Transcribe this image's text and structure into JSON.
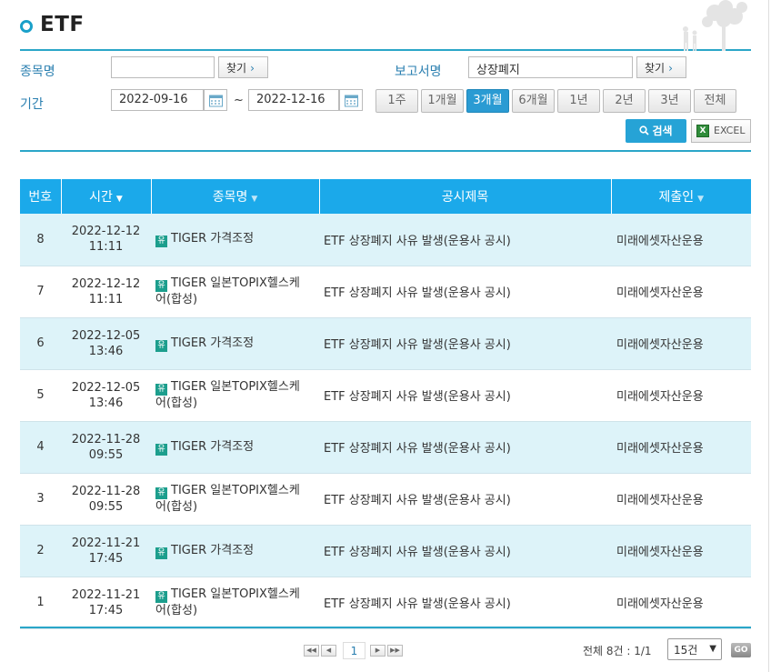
{
  "header": {
    "title": "ETF"
  },
  "search": {
    "stock_label": "종목명",
    "stock_value": "",
    "find_label": "찾기",
    "report_label": "보고서명",
    "report_value": "상장폐지",
    "period_label": "기간",
    "start_date": "2022-09-16",
    "end_date": "2022-12-16",
    "tilde": "~",
    "periods": [
      "1주",
      "1개월",
      "3개월",
      "6개월",
      "1년",
      "2년",
      "3년",
      "전체"
    ],
    "active_period": "3개월",
    "search_button": "검색",
    "excel_button": "EXCEL"
  },
  "table": {
    "headers": [
      "번호",
      "시간",
      "종목명",
      "공시제목",
      "제출인"
    ],
    "rows": [
      {
        "no": "8",
        "date": "2022-12-12",
        "time": "11:11",
        "name1": "TIGER 가격조정",
        "name2": "",
        "title": "ETF 상장폐지 사유 발생(운용사 공시)",
        "submitter": "미래에셋자산운용"
      },
      {
        "no": "7",
        "date": "2022-12-12",
        "time": "11:11",
        "name1": "TIGER 일본TOPIX헬스케",
        "name2": "어(합성)",
        "title": "ETF 상장폐지 사유 발생(운용사 공시)",
        "submitter": "미래에셋자산운용"
      },
      {
        "no": "6",
        "date": "2022-12-05",
        "time": "13:46",
        "name1": "TIGER 가격조정",
        "name2": "",
        "title": "ETF 상장폐지 사유 발생(운용사 공시)",
        "submitter": "미래에셋자산운용"
      },
      {
        "no": "5",
        "date": "2022-12-05",
        "time": "13:46",
        "name1": "TIGER 일본TOPIX헬스케",
        "name2": "어(합성)",
        "title": "ETF 상장폐지 사유 발생(운용사 공시)",
        "submitter": "미래에셋자산운용"
      },
      {
        "no": "4",
        "date": "2022-11-28",
        "time": "09:55",
        "name1": "TIGER 가격조정",
        "name2": "",
        "title": "ETF 상장폐지 사유 발생(운용사 공시)",
        "submitter": "미래에셋자산운용"
      },
      {
        "no": "3",
        "date": "2022-11-28",
        "time": "09:55",
        "name1": "TIGER 일본TOPIX헬스케",
        "name2": "어(합성)",
        "title": "ETF 상장폐지 사유 발생(운용사 공시)",
        "submitter": "미래에셋자산운용"
      },
      {
        "no": "2",
        "date": "2022-11-21",
        "time": "17:45",
        "name1": "TIGER 가격조정",
        "name2": "",
        "title": "ETF 상장폐지 사유 발생(운용사 공시)",
        "submitter": "미래에셋자산운용"
      },
      {
        "no": "1",
        "date": "2022-11-21",
        "time": "17:45",
        "name1": "TIGER 일본TOPIX헬스케",
        "name2": "어(합성)",
        "title": "ETF 상장폐지 사유 발생(운용사 공시)",
        "submitter": "미래에셋자산운용"
      }
    ]
  },
  "pagination": {
    "current_page": "1",
    "total_text": "전체 8건 : 1/1",
    "page_size": "15건",
    "go_label": "GO"
  },
  "colors": {
    "accent": "#1ba9ea",
    "active_period": "#2a9bd3",
    "row_alt": "#ddf3f9"
  }
}
